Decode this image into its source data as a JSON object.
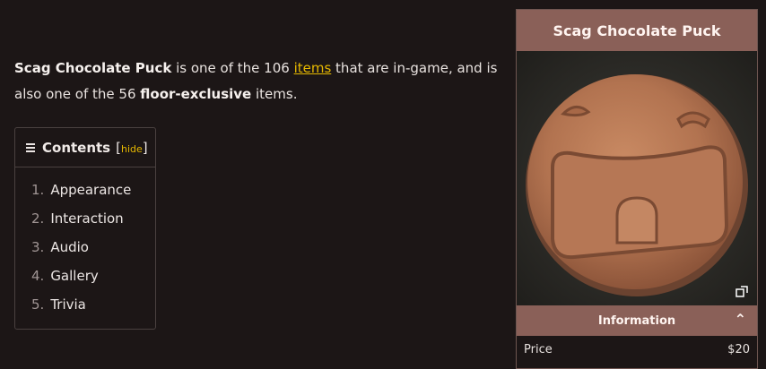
{
  "intro": {
    "item_name": "Scag Chocolate Puck",
    "text1": " is one of the 106 ",
    "items_link": "items",
    "text2": " that are in-game, and is also one of the 56 ",
    "floor_exclusive": "floor-exclusive",
    "text3": " items."
  },
  "toc": {
    "title": "Contents",
    "bracket_open": "[",
    "hide_label": "hide",
    "bracket_close": "]",
    "items": [
      {
        "num": "1.",
        "label": "Appearance"
      },
      {
        "num": "2.",
        "label": "Interaction"
      },
      {
        "num": "3.",
        "label": "Audio"
      },
      {
        "num": "4.",
        "label": "Gallery"
      },
      {
        "num": "5.",
        "label": "Trivia"
      }
    ]
  },
  "infobox": {
    "title": "Scag Chocolate Puck",
    "section": "Information",
    "row_label": "Price",
    "row_value": "$20"
  },
  "colors": {
    "accent": "#8a6058",
    "link": "#e6b800",
    "background": "#1c1616"
  }
}
